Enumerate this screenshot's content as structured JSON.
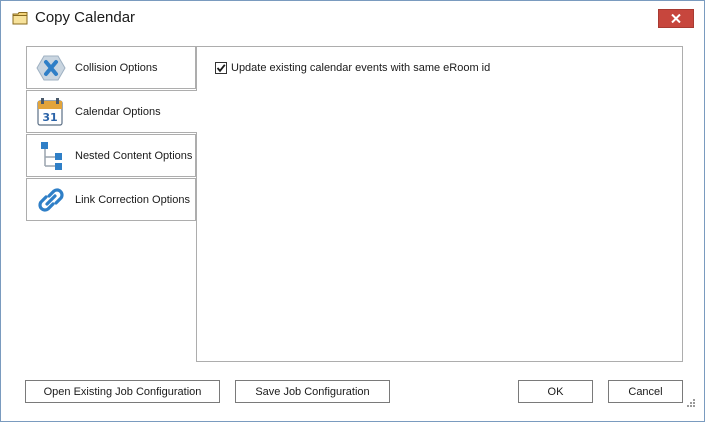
{
  "window": {
    "title": "Copy Calendar",
    "icons": {
      "title": "folder-icon",
      "close": "close-icon"
    },
    "colors": {
      "close_button": "#c7463d",
      "border": "#7a9bbf"
    }
  },
  "tabs": [
    {
      "label": "Collision Options",
      "icon": "collision-x-icon",
      "selected": false
    },
    {
      "label": "Calendar Options",
      "icon": "calendar-31-icon",
      "selected": true
    },
    {
      "label": "Nested Content Options",
      "icon": "tree-hierarchy-icon",
      "selected": false
    },
    {
      "label": "Link Correction Options",
      "icon": "chain-link-icon",
      "selected": false
    }
  ],
  "calendar_panel": {
    "update_events_checkbox": {
      "label": "Update existing calendar events with same eRoom id",
      "checked": true
    }
  },
  "buttons": {
    "open_job": "Open Existing Job Configuration",
    "save_job": "Save Job Configuration",
    "ok": "OK",
    "cancel": "Cancel"
  }
}
